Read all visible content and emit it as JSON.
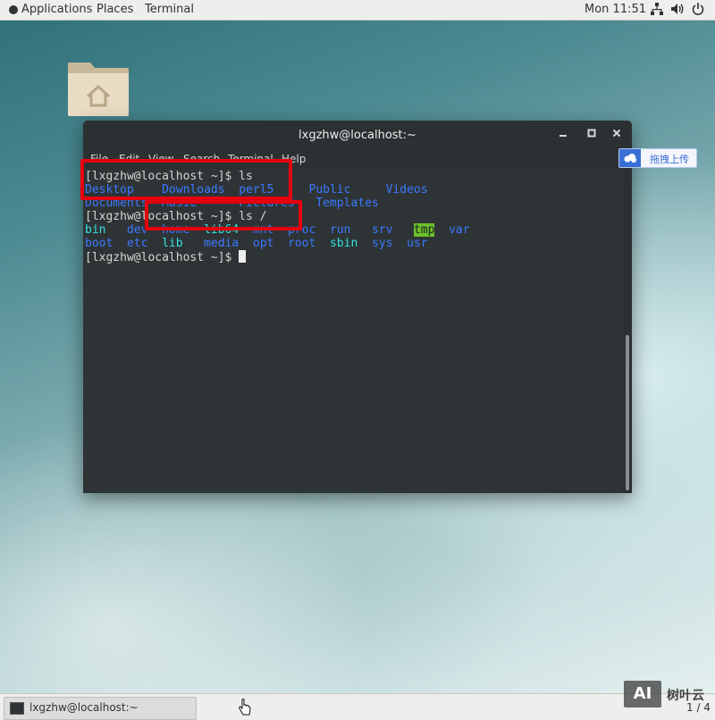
{
  "topbar": {
    "applications": "Applications",
    "places": "Places",
    "terminal": "Terminal",
    "clock": "Mon 11:51"
  },
  "window": {
    "title": "lxgzhw@localhost:~",
    "menus": [
      "File",
      "Edit",
      "View",
      "Search",
      "Terminal",
      "Help"
    ]
  },
  "terminal": {
    "prompt1": "[lxgzhw@localhost ~]$ ls",
    "home_row1": [
      "Desktop",
      "Downloads",
      "perl5",
      "Public",
      "Videos"
    ],
    "home_row2": [
      "Documents",
      "Music",
      "Pictures",
      "Templates"
    ],
    "prompt2": "[lxgzhw@localhost ~]$ ls /",
    "root_row1": [
      "bin",
      "dev",
      "home",
      "lib64",
      "mnt",
      "proc",
      "run",
      "srv",
      "tmp",
      "var"
    ],
    "root_row2": [
      "boot",
      "etc",
      "lib",
      "media",
      "opt",
      "root",
      "sbin",
      "sys",
      "usr"
    ],
    "prompt3": "[lxgzhw@localhost ~]$ "
  },
  "upload_widget": {
    "label": "拖拽上传"
  },
  "taskbar": {
    "task_label": "lxgzhw@localhost:~",
    "workspace": "1 / 4"
  },
  "watermark": {
    "logo": "AI",
    "text": "树叶云"
  },
  "colors": {
    "terminal_bg": "#2e3436",
    "dir_blue": "#3b78ff",
    "link_cyan": "#34e2e2",
    "tmp_highlight": "#6bc12c",
    "annotation_red": "#e6000f"
  }
}
